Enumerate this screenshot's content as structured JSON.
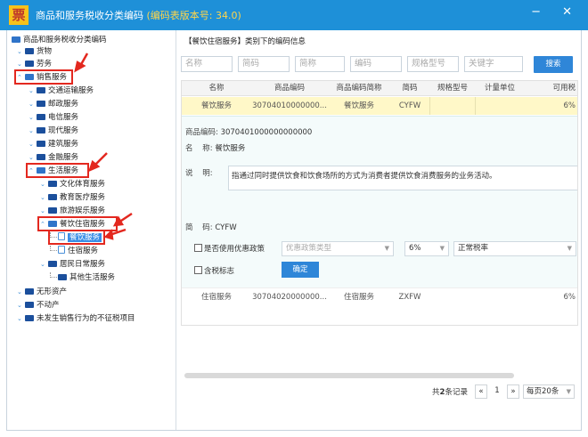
{
  "window": {
    "logo": "票",
    "title": "商品和服务税收分类编码",
    "version": "(编码表版本号: 34.0)",
    "controls": "−  ✕"
  },
  "tree": {
    "root": "商品和服务税收分类编码",
    "items": [
      {
        "label": "货物"
      },
      {
        "label": "劳务"
      },
      {
        "label": "销售服务"
      },
      {
        "label": "交通运输服务"
      },
      {
        "label": "邮政服务"
      },
      {
        "label": "电信服务"
      },
      {
        "label": "现代服务"
      },
      {
        "label": "建筑服务"
      },
      {
        "label": "金融服务"
      },
      {
        "label": "生活服务"
      },
      {
        "label": "文化体育服务"
      },
      {
        "label": "教育医疗服务"
      },
      {
        "label": "旅游娱乐服务"
      },
      {
        "label": "餐饮住宿服务"
      },
      {
        "label": "餐饮服务"
      },
      {
        "label": "住宿服务"
      },
      {
        "label": "居民日常服务"
      },
      {
        "label": "其他生活服务"
      },
      {
        "label": "无形资产"
      },
      {
        "label": "不动产"
      },
      {
        "label": "未发生销售行为的不征税项目"
      }
    ]
  },
  "panel": {
    "heading": "【餐饮住宿服务】类别下的编码信息"
  },
  "search": {
    "fields": [
      "名称",
      "简码",
      "简称",
      "编码",
      "规格型号",
      "关键字"
    ],
    "button": "搜索"
  },
  "grid": {
    "headers": [
      "名称",
      "商品编码",
      "商品编码简称",
      "简码",
      "规格型号",
      "计量单位",
      "可用税"
    ],
    "rows": [
      [
        "餐饮服务",
        "30704010000000...",
        "餐饮服务",
        "CYFW",
        "",
        "",
        "6%"
      ],
      [
        "住宿服务",
        "30704020000000...",
        "住宿服务",
        "ZXFW",
        "",
        "",
        "6%"
      ]
    ]
  },
  "detail": {
    "code_label": "商品编码:",
    "code_value": "3070401000000000000",
    "name_label": "名    称:",
    "name_value": "餐饮服务",
    "desc_label": "说    明:",
    "desc_value": "指通过同时提供饮食和饮食场所的方式为消费者提供饮食消费服务的业务活动。",
    "short_label": "简    码:",
    "short_value": "CYFW",
    "preferential_label": "是否使用优惠政策",
    "policy_placeholder": "优惠政策类型",
    "rate_value": "6%",
    "rate_type": "正常税率",
    "tax_included_label": "含税标志",
    "confirm_button": "确定"
  },
  "pager": {
    "total_prefix": "共",
    "total_count": "2",
    "total_suffix": "条记录",
    "prev": "«",
    "page": "1",
    "next": "»",
    "page_size": "每页20条"
  },
  "colors": {
    "titlebar": "#1e90d8",
    "accent": "#2f86d8",
    "highlight_row": "#fff8c8",
    "annotation": "#e3281f"
  }
}
